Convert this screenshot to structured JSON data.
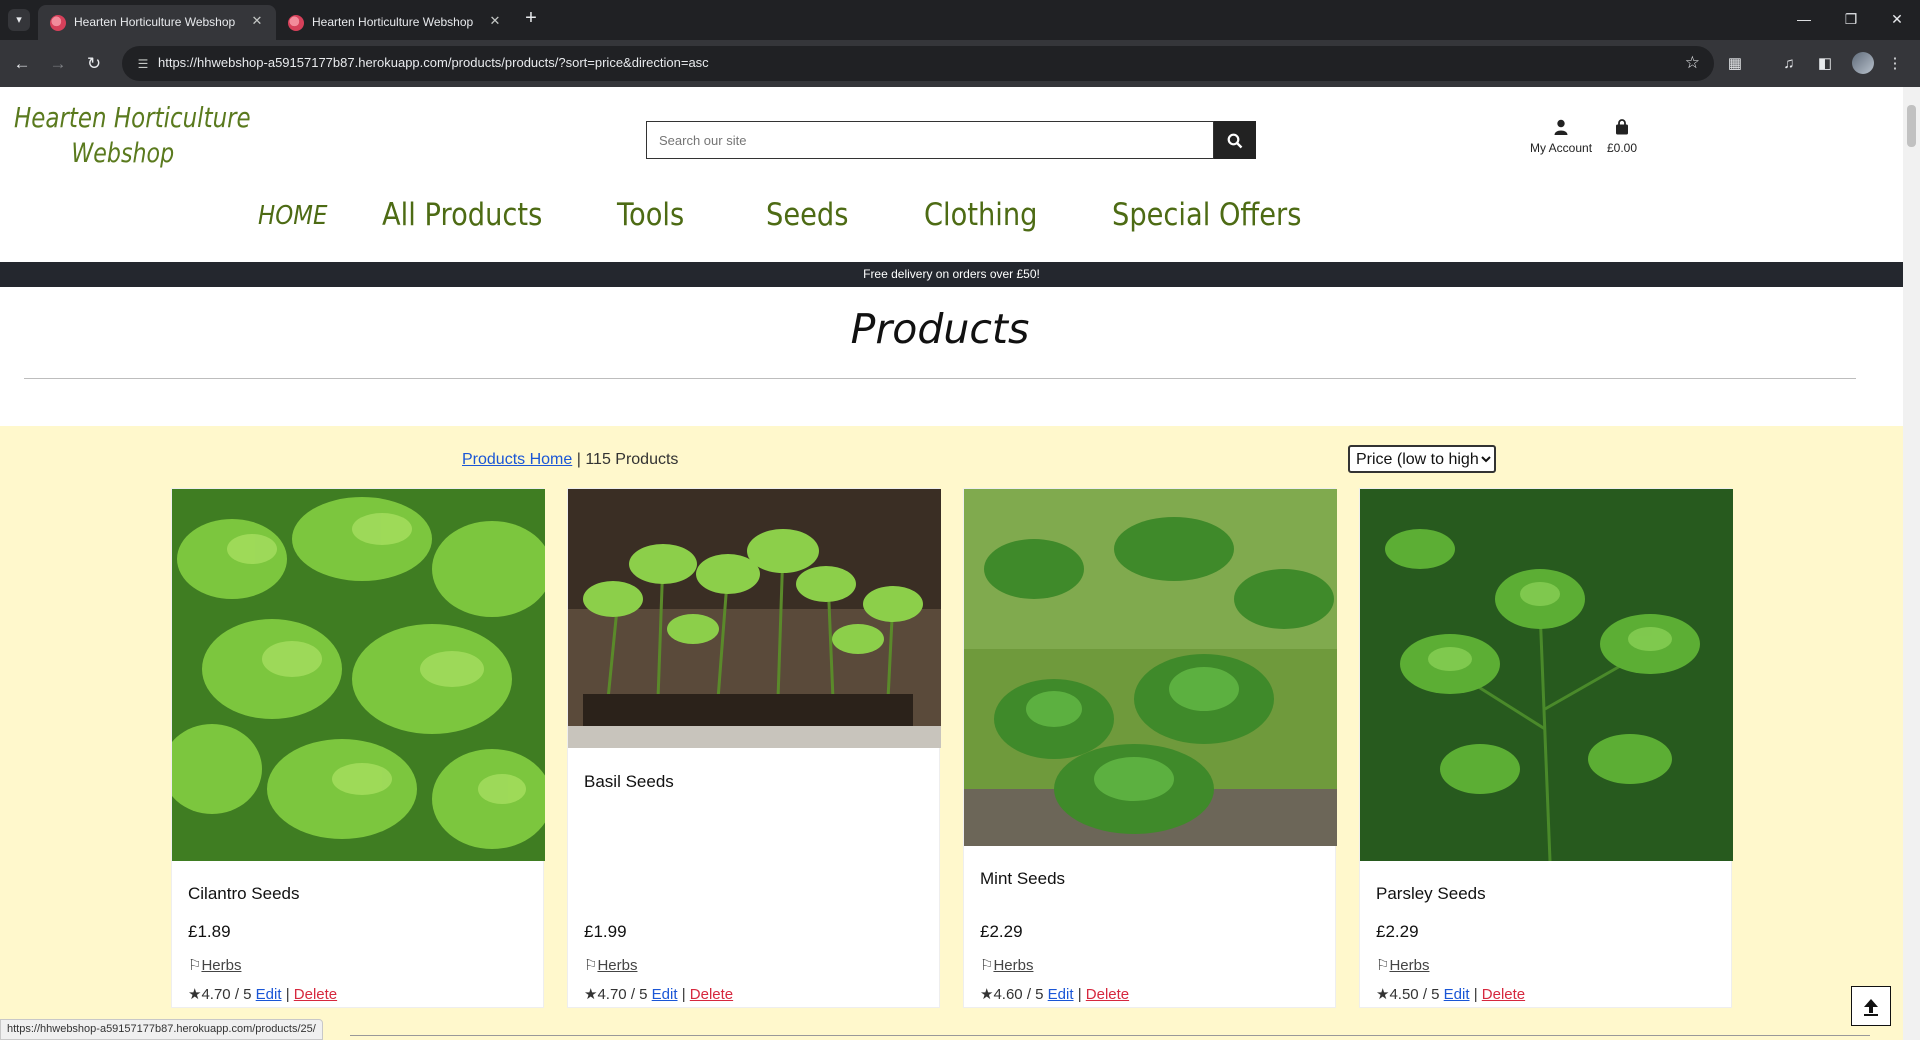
{
  "browser": {
    "tabs": [
      {
        "title": "Hearten Horticulture Webshop",
        "active": true
      },
      {
        "title": "Hearten Horticulture Webshop",
        "active": false
      }
    ],
    "url": "https://hhwebshop-a59157177b87.herokuapp.com/products/products/?sort=price&direction=asc",
    "status_url": "https://hhwebshop-a59157177b87.herokuapp.com/products/25/"
  },
  "site": {
    "logo_line1": "Hearten Horticulture",
    "logo_line2": "Webshop",
    "search_placeholder": "Search our site",
    "account_label": "My Account",
    "basket_total": "£0.00",
    "nav": [
      "HOME",
      "All Products",
      "Tools",
      "Seeds",
      "Clothing",
      "Special Offers"
    ],
    "promo": "Free delivery on orders over £50!"
  },
  "page": {
    "title": "Products",
    "breadcrumb_link": "Products Home",
    "product_count": "115 Products",
    "sort_selected": "Price (low to high)"
  },
  "products": [
    {
      "name": "Cilantro Seeds",
      "price": "£1.89",
      "category": "Herbs",
      "rating": "4.70 / 5",
      "edit": "Edit",
      "delete": "Delete"
    },
    {
      "name": "Basil Seeds",
      "price": "£1.99",
      "category": "Herbs",
      "rating": "4.70 / 5",
      "edit": "Edit",
      "delete": "Delete"
    },
    {
      "name": "Mint Seeds",
      "price": "£2.29",
      "category": "Herbs",
      "rating": "4.60 / 5",
      "edit": "Edit",
      "delete": "Delete"
    },
    {
      "name": "Parsley Seeds",
      "price": "£2.29",
      "category": "Herbs",
      "rating": "4.50 / 5",
      "edit": "Edit",
      "delete": "Delete"
    }
  ],
  "colors": {
    "brand_green": "#4d6b14",
    "content_bg": "#fff8cc",
    "promo_bar": "#24272e",
    "link_blue": "#1a56d6",
    "delete_red": "#d6283e"
  },
  "icons": {
    "search": "search-icon",
    "account": "user-icon",
    "basket": "shopping-bag-icon",
    "category": "tag-icon",
    "rating": "star-icon",
    "back_to_top": "arrow-up-icon"
  }
}
